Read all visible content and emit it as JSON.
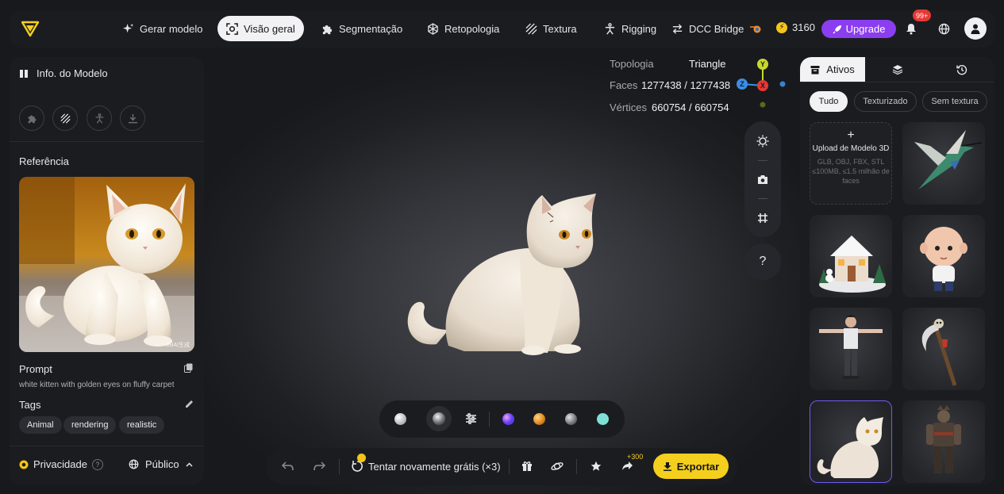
{
  "nav": {
    "items": [
      {
        "label": "Gerar modelo",
        "icon": "sparkle-icon"
      },
      {
        "label": "Visão geral",
        "icon": "scan-icon"
      },
      {
        "label": "Segmentação",
        "icon": "puzzle-icon"
      },
      {
        "label": "Retopologia",
        "icon": "mesh-icon"
      },
      {
        "label": "Textura",
        "icon": "texture-icon"
      },
      {
        "label": "Rigging",
        "icon": "figure-icon"
      },
      {
        "label": "DCC Bridge",
        "icon": "swap-icon"
      }
    ],
    "active": "Visão geral",
    "credits": "3160",
    "upgrade_label": "Upgrade",
    "notifications_badge": "99+"
  },
  "left": {
    "title": "Info. do Modelo",
    "reference_label": "Referência",
    "watermark": "BBAI生成",
    "prompt_label": "Prompt",
    "prompt_text": "white kitten with golden eyes on fluffy carpet",
    "tags_label": "Tags",
    "tags": [
      "Animal",
      "rendering",
      "realistic"
    ],
    "privacy_label": "Privacidade",
    "privacy_help": "?",
    "visibility_label": "Público"
  },
  "stats": {
    "topology_label": "Topologia",
    "topology_value": "Triangle",
    "faces_label": "Faces",
    "faces_value": "1277438 / 1277438",
    "vertices_label": "Vértices",
    "vertices_value": "660754 / 660754"
  },
  "gizmo": {
    "y": "Y",
    "z": "Z",
    "x": "X"
  },
  "tools": {
    "help": "?"
  },
  "actions": {
    "retry_label": "Tentar novamente grátis (×3)",
    "share_bonus": "+300",
    "export_label": "Exportar"
  },
  "right": {
    "tab_assets": "Ativos",
    "filters": [
      "Tudo",
      "Texturizado",
      "Sem textura"
    ],
    "upload_plus": "+",
    "upload_title": "Upload de Modelo 3D",
    "upload_sub": "GLB, OBJ, FBX, STL ≤100MB, ≤1.5 milhão de faces"
  },
  "colors": {
    "accent": "#f5cf1d",
    "upgrade": "#8b3df0",
    "axis_y": "#c6d92c",
    "axis_z": "#3a8ee6",
    "axis_x": "#e53935"
  }
}
